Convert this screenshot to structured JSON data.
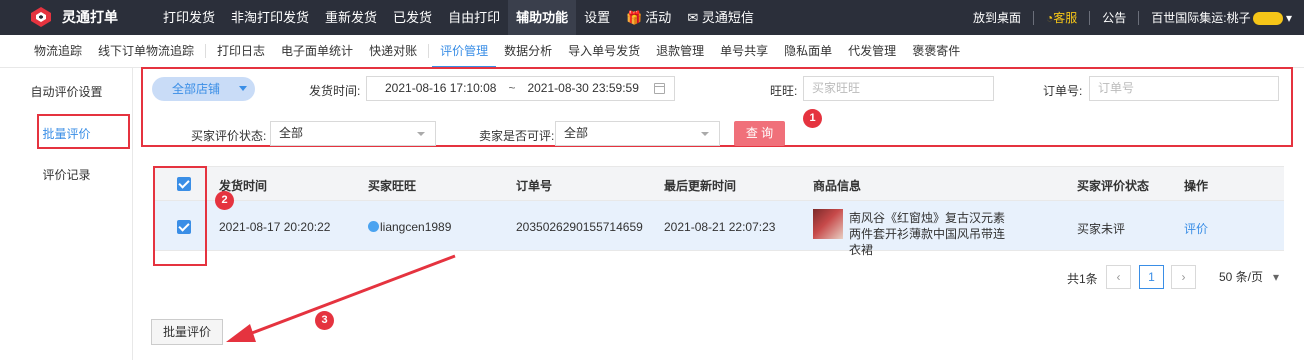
{
  "app": {
    "title": "灵通打单"
  },
  "topnav": {
    "items": [
      "打印发货",
      "非淘打印发货",
      "重新发货",
      "已发货",
      "自由打印",
      "辅助功能",
      "设置",
      "活动",
      "灵通短信"
    ],
    "active": "辅助功能"
  },
  "top_right": {
    "desktop": "放到桌面",
    "service": "客服",
    "notice": "公告",
    "user": "百世国际集运:桃子"
  },
  "subnav": {
    "group1": [
      "物流追踪",
      "线下订单物流追踪"
    ],
    "group2": [
      "打印日志",
      "电子面单统计",
      "快递对账"
    ],
    "group3": [
      "评价管理",
      "数据分析",
      "导入单号发货",
      "退款管理",
      "单号共享",
      "隐私面单",
      "代发管理",
      "褒褒寄件"
    ],
    "active": "评价管理"
  },
  "sidebar": {
    "items": [
      "自动评价设置",
      "批量评价",
      "评价记录"
    ],
    "active": "批量评价"
  },
  "filters": {
    "store_button": "全部店铺",
    "ship_time_label": "发货时间:",
    "date_from": "2021-08-16 17:10:08",
    "date_sep": "~",
    "date_to": "2021-08-30 23:59:59",
    "wangwang_label": "旺旺:",
    "wangwang_placeholder": "买家旺旺",
    "order_label": "订单号:",
    "order_placeholder": "订单号",
    "buyer_status_label": "买家评价状态:",
    "buyer_status_value": "全部",
    "seller_can_label": "卖家是否可评:",
    "seller_can_value": "全部",
    "query_button": "查 询"
  },
  "table": {
    "headers": [
      "发货时间",
      "买家旺旺",
      "订单号",
      "最后更新时间",
      "商品信息",
      "买家评价状态",
      "操作"
    ],
    "rows": [
      {
        "ship_time": "2021-08-17 20:20:22",
        "buyer": "liangcen1989",
        "order_no": "2035026290155714659",
        "updated": "2021-08-21 22:07:23",
        "product": "南风谷《红窗烛》复古汉元素两件套开衫薄款中国风吊带连衣裙",
        "status": "买家未评",
        "action": "评价"
      }
    ]
  },
  "pagination": {
    "total": "共1条",
    "current": "1",
    "page_size": "50 条/页"
  },
  "batch_button": "批量评价",
  "annotations": {
    "badge1": "1",
    "badge2": "2",
    "badge3": "3",
    "color": "#e5333f"
  }
}
